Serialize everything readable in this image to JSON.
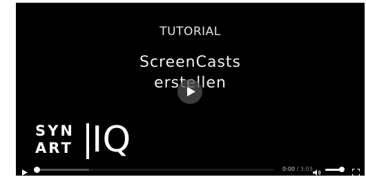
{
  "video": {
    "tutorial_label": "TUTORIAL",
    "title_line1": "ScreenCasts",
    "title_line2": "erstellen"
  },
  "logo": {
    "line1": "SYN",
    "line2": "ART",
    "mark": "IQ"
  },
  "controls": {
    "current_time": "0:00",
    "separator": "/",
    "duration": "3:03",
    "progress_fraction": 0.0,
    "buffered_fraction": 0.22,
    "volume_fraction": 0.85,
    "icons": {
      "play": "play-icon",
      "overlay_play": "play-icon",
      "volume": "volume-icon",
      "fullscreen": "fullscreen-icon"
    }
  },
  "colors": {
    "background": "#000000",
    "text": "#f0f0f0",
    "track": "#1c1c1c",
    "buffer": "#555555",
    "accent": "#ffffff"
  }
}
